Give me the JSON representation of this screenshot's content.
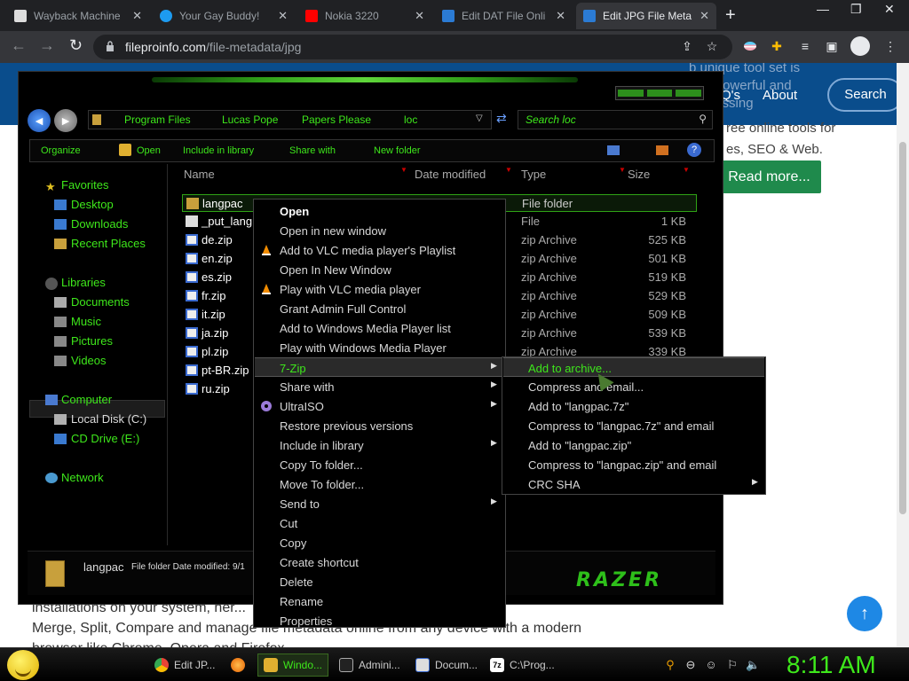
{
  "browser": {
    "tabs": [
      {
        "title": "Wayback Machine",
        "icon": "wayback-icon",
        "active": false
      },
      {
        "title": "Your Gay Buddy!",
        "icon": "twitter-icon",
        "active": false
      },
      {
        "title": "Nokia 3220",
        "icon": "youtube-icon",
        "active": false
      },
      {
        "title": "Edit DAT File Onli",
        "icon": "fileproinfo-icon",
        "active": false
      },
      {
        "title": "Edit JPG File Meta",
        "icon": "fileproinfo-icon",
        "active": true
      }
    ],
    "url_domain": "fileproinfo.com",
    "url_path": "/file-metadata/jpg"
  },
  "webpage": {
    "nav_partial": "Q's",
    "nav_about": "About",
    "nav_search": "Search",
    "faint_text": "b unique tool set is\ncsy, powerful and\nprocessing",
    "text_line1": "ree online tools for",
    "text_line2": "es, SEO & Web.",
    "read_more": "Read more...",
    "bottom_line1": "installations on your system, her...                                       w, Convert, Edit,",
    "bottom_line2": "Merge, Split, Compare and manage file metadata online from any device with a modern",
    "bottom_line3": "browser like Chrome, Opera and Firefox.",
    "colors": {
      "header": "#0a4d8c",
      "button_green": "#1f8a4c",
      "fab": "#1e88e5"
    }
  },
  "explorer": {
    "breadcrumbs": [
      "Program Files",
      "Lucas Pope",
      "Papers Please",
      "loc"
    ],
    "search_placeholder": "Search loc",
    "commands": [
      "Organize",
      "Open",
      "Include in library",
      "Share with",
      "New folder"
    ],
    "nav": {
      "favorites": "Favorites",
      "fav_items": [
        "Desktop",
        "Downloads",
        "Recent Places"
      ],
      "libraries": "Libraries",
      "lib_items": [
        "Documents",
        "Music",
        "Pictures",
        "Videos"
      ],
      "computer": "Computer",
      "comp_items": [
        "Local Disk (C:)",
        "CD Drive (E:)"
      ],
      "network": "Network"
    },
    "columns": [
      "Name",
      "Date modified",
      "Type",
      "Size"
    ],
    "files": [
      {
        "name": "langpac",
        "type": "File folder",
        "size": ""
      },
      {
        "name": "_put_lang",
        "type": "File",
        "size": "1 KB"
      },
      {
        "name": "de.zip",
        "type": "zip Archive",
        "size": "525 KB"
      },
      {
        "name": "en.zip",
        "type": "zip Archive",
        "size": "501 KB"
      },
      {
        "name": "es.zip",
        "type": "zip Archive",
        "size": "519 KB"
      },
      {
        "name": "fr.zip",
        "type": "zip Archive",
        "size": "529 KB"
      },
      {
        "name": "it.zip",
        "type": "zip Archive",
        "size": "509 KB"
      },
      {
        "name": "ja.zip",
        "type": "zip Archive",
        "size": "539 KB"
      },
      {
        "name": "pl.zip",
        "type": "zip Archive",
        "size": "339 KB"
      },
      {
        "name": "pt-BR.zip",
        "type": "",
        "size": ""
      },
      {
        "name": "ru.zip",
        "type": "",
        "size": ""
      }
    ],
    "details_name": "langpac",
    "details_info": "File folder  Date modified: 9/1",
    "logo_text": "RAZER",
    "accent": "#3ee81b"
  },
  "context_menu": {
    "items": [
      {
        "label": "Open",
        "bold": true
      },
      {
        "label": "Open in new window"
      },
      {
        "label": "Add to VLC media player's Playlist",
        "icon": "vlc-icon"
      },
      {
        "label": "Open In New Window"
      },
      {
        "label": "Play with VLC media player",
        "icon": "vlc-icon"
      },
      {
        "label": "Grant Admin Full Control"
      },
      {
        "label": "Add to Windows Media Player list"
      },
      {
        "label": "Play with Windows Media Player"
      },
      {
        "label": "7-Zip",
        "submenu": true,
        "highlight": true
      },
      {
        "label": "Share with",
        "submenu": true
      },
      {
        "label": "UltraISO",
        "submenu": true,
        "icon": "ultraiso-icon"
      },
      {
        "label": "Restore previous versions"
      },
      {
        "label": "Include in library",
        "submenu": true
      },
      {
        "label": "Copy To folder..."
      },
      {
        "label": "Move To folder..."
      },
      {
        "label": "Send to",
        "submenu": true
      },
      {
        "label": "Cut"
      },
      {
        "label": "Copy"
      },
      {
        "label": "Create shortcut"
      },
      {
        "label": "Delete"
      },
      {
        "label": "Rename"
      },
      {
        "label": "Properties"
      }
    ]
  },
  "submenu_7zip": {
    "items": [
      {
        "label": "Add to archive...",
        "highlight": true
      },
      {
        "label": "Compress and email..."
      },
      {
        "label": "Add to \"langpac.7z\""
      },
      {
        "label": "Compress to \"langpac.7z\" and email"
      },
      {
        "label": "Add to \"langpac.zip\""
      },
      {
        "label": "Compress to \"langpac.zip\" and email"
      },
      {
        "label": "CRC SHA",
        "submenu": true
      }
    ]
  },
  "taskbar": {
    "buttons": [
      {
        "label": "Edit JP...",
        "icon": "chrome-icon"
      },
      {
        "label": "",
        "icon": "firefox-icon"
      },
      {
        "label": "Windo...",
        "icon": "explorer-icon",
        "active": true
      },
      {
        "label": "Admini...",
        "icon": "cmd-icon"
      },
      {
        "label": "Docum...",
        "icon": "document-icon"
      },
      {
        "label": "C:\\Prog...",
        "icon": "7zip-icon"
      }
    ],
    "clock": "8:11 AM"
  }
}
